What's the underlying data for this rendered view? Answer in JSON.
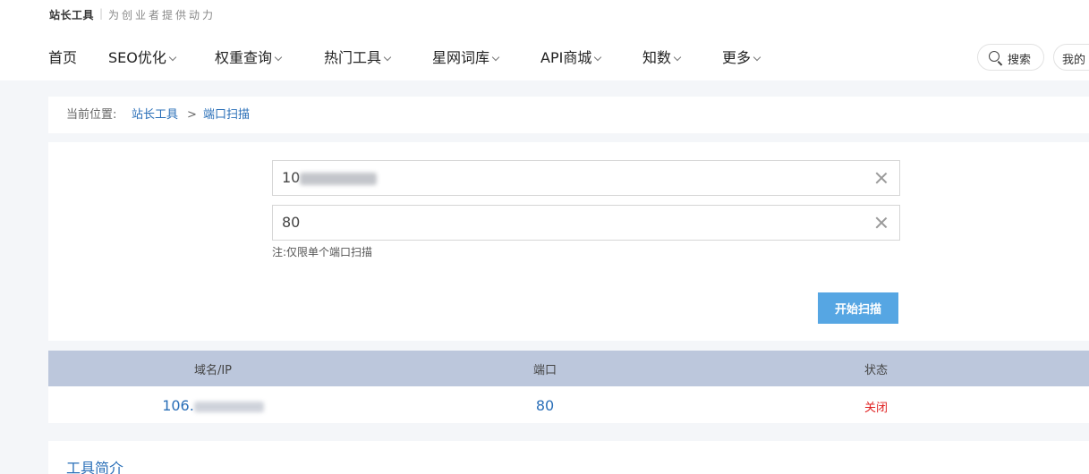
{
  "header": {
    "brand": "站长工具",
    "separator": "|",
    "slogan": "为创业者提供动力",
    "nav": [
      {
        "label": "首页",
        "has_dropdown": false
      },
      {
        "label": "SEO优化",
        "has_dropdown": true
      },
      {
        "label": "权重查询",
        "has_dropdown": true
      },
      {
        "label": "热门工具",
        "has_dropdown": true
      },
      {
        "label": "星网词库",
        "has_dropdown": true
      },
      {
        "label": "API商城",
        "has_dropdown": true
      },
      {
        "label": "知数",
        "has_dropdown": true
      },
      {
        "label": "更多",
        "has_dropdown": true
      }
    ],
    "search_label": "搜索",
    "mine_label": "我的"
  },
  "breadcrumb": {
    "prefix": "当前位置:",
    "home": "站长工具",
    "separator": ">",
    "current": "端口扫描"
  },
  "form": {
    "host_value_visible": "10",
    "port_value": "80",
    "note": "注:仅限单个端口扫描",
    "scan_button": "开始扫描"
  },
  "results": {
    "headers": [
      "域名/IP",
      "端口",
      "状态"
    ],
    "rows": [
      {
        "ip_visible": "106.",
        "port": "80",
        "status": "关闭"
      }
    ],
    "status_color": "#e02020"
  },
  "intro": {
    "title": "工具简介"
  },
  "colors": {
    "accent": "#2a6fb8",
    "button": "#56a6e3",
    "table_header": "#bcc7dc",
    "background": "#f4f6f9"
  }
}
